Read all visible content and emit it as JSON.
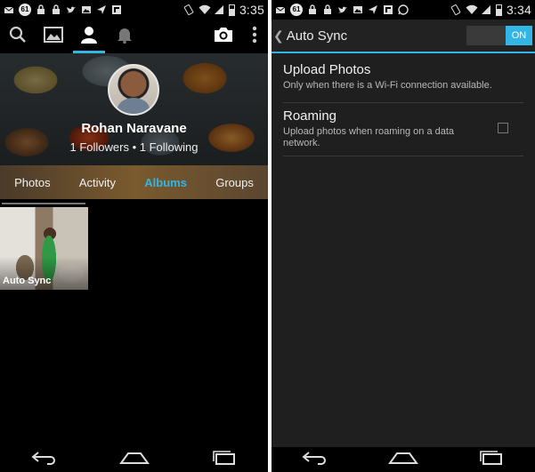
{
  "left": {
    "status": {
      "badge": "61",
      "time": "3:35"
    },
    "profile": {
      "name": "Rohan Naravane",
      "follow_line": "1 Followers • 1 Following"
    },
    "tabs": [
      {
        "label": "Photos",
        "selected": false
      },
      {
        "label": "Activity",
        "selected": false
      },
      {
        "label": "Albums",
        "selected": true
      },
      {
        "label": "Groups",
        "selected": false
      }
    ],
    "album": {
      "label": "Auto Sync"
    }
  },
  "right": {
    "status": {
      "badge": "61",
      "time": "3:34"
    },
    "action_bar": {
      "title": "Auto Sync",
      "toggle": "ON"
    },
    "prefs": [
      {
        "title": "Upload Photos",
        "summary": "Only when there is a Wi-Fi connection available."
      },
      {
        "title": "Roaming",
        "summary": "Upload photos when roaming on a data network.",
        "checked": false
      }
    ]
  },
  "colors": {
    "accent": "#33b5e5",
    "background": "#000000",
    "panel": "#1f1f1f"
  },
  "icons": [
    "search-icon",
    "gallery-icon",
    "profile-icon",
    "bell-icon",
    "camera-icon",
    "overflow-icon",
    "back-nav-icon",
    "home-nav-icon",
    "recents-nav-icon"
  ]
}
